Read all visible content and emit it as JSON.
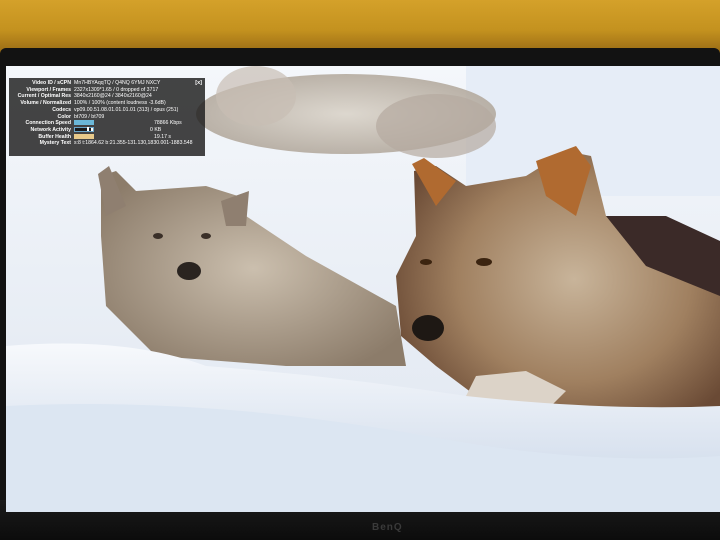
{
  "monitor": {
    "brand": "BenQ"
  },
  "stats_panel": {
    "close_label": "[x]",
    "rows": [
      {
        "label": "Video ID / sCPN",
        "value": "Mn7HBYAqqTQ / Q4NQ 6YMJ NXCY"
      },
      {
        "label": "Viewport / Frames",
        "value": "2327x1309*1.65 / 0 dropped of 3717"
      },
      {
        "label": "Current / Optimal Res",
        "value": "3840x2160@24 / 3840x2160@24"
      },
      {
        "label": "Volume / Normalized",
        "value": "100% / 100% (content loudness -3.6dB)"
      },
      {
        "label": "Codecs",
        "value": "vp09.00.51.08.01.01.01.01 (313) / opus (251)"
      },
      {
        "label": "Color",
        "value": "bt709 / bt709"
      },
      {
        "label": "Connection Speed",
        "value": "78866 Kbps"
      },
      {
        "label": "Network Activity",
        "value": "0 KB"
      },
      {
        "label": "Buffer Health",
        "value": "19.17 s"
      },
      {
        "label": "Mystery Text",
        "value": "s:8 t:1864.62 b:21.355-131.130,1830.001-1883.548"
      }
    ],
    "colors": {
      "connection": "#6bb7d8",
      "network": "#2b8a4a",
      "buffer": "#e7c98a"
    }
  }
}
